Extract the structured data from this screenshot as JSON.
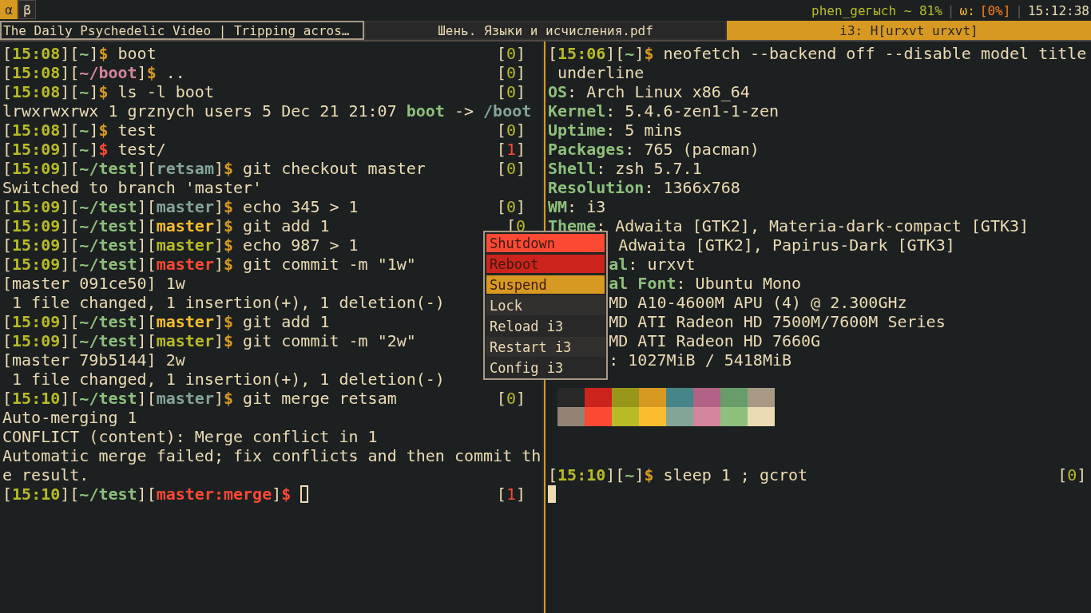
{
  "top_bar": {
    "workspaces": [
      {
        "label": "α",
        "selected": true
      },
      {
        "label": "β",
        "selected": false
      }
    ],
    "status": [
      {
        "text": "phen_geгысh ~ 81%",
        "kind": "net"
      },
      {
        "text": "|",
        "kind": "sep"
      },
      {
        "text": "ω:",
        "kind": "label"
      },
      {
        "text": "[0%]",
        "kind": "value"
      },
      {
        "text": "|",
        "kind": "sep"
      },
      {
        "text": "15:12:38",
        "kind": "clock"
      }
    ]
  },
  "tabs": [
    {
      "title": "The Daily Psychedelic Video | Tripping acros…",
      "kind": "focused-inactive",
      "selected": false
    },
    {
      "title": "Шень. Языки и исчисления.pdf",
      "kind": "unfocused",
      "selected": false
    },
    {
      "title": "i3: H[urxvt urxvt]",
      "kind": "unfocused",
      "selected": true
    }
  ],
  "left_terminal": {
    "lines": [
      {
        "segments": [
          {
            "text": "[",
            "kind": "text"
          },
          {
            "text": "15:08",
            "kind": "time"
          },
          {
            "text": "][",
            "kind": "text"
          },
          {
            "text": "~",
            "kind": "cwd"
          },
          {
            "text": "]",
            "kind": "text"
          },
          {
            "text": "$",
            "kind": "sign"
          },
          {
            "text": " boot",
            "kind": "text"
          }
        ],
        "status": [
          {
            "text": "[",
            "kind": "text"
          },
          {
            "text": "0",
            "kind": "ok"
          },
          {
            "text": "]",
            "kind": "text"
          }
        ]
      },
      {
        "segments": [
          {
            "text": "[",
            "kind": "text"
          },
          {
            "text": "15:08",
            "kind": "time"
          },
          {
            "text": "][",
            "kind": "text"
          },
          {
            "text": "~/boot",
            "kind": "cwd-link"
          },
          {
            "text": "]",
            "kind": "text"
          },
          {
            "text": "$",
            "kind": "sign"
          },
          {
            "text": " ..",
            "kind": "text"
          }
        ],
        "status": [
          {
            "text": "[",
            "kind": "text"
          },
          {
            "text": "0",
            "kind": "ok"
          },
          {
            "text": "]",
            "kind": "text"
          }
        ]
      },
      {
        "segments": [
          {
            "text": "[",
            "kind": "text"
          },
          {
            "text": "15:08",
            "kind": "time"
          },
          {
            "text": "][",
            "kind": "text"
          },
          {
            "text": "~",
            "kind": "cwd"
          },
          {
            "text": "]",
            "kind": "text"
          },
          {
            "text": "$",
            "kind": "sign"
          },
          {
            "text": " ls -l boot",
            "kind": "text"
          }
        ],
        "status": [
          {
            "text": "[",
            "kind": "text"
          },
          {
            "text": "0",
            "kind": "ok"
          },
          {
            "text": "]",
            "kind": "text"
          }
        ]
      },
      {
        "segments": [
          {
            "text": "lrwxrwxrwx 1 grznych users 5 Dec 21 21:07 ",
            "kind": "text"
          },
          {
            "text": "boot",
            "kind": "link-name"
          },
          {
            "text": " -> ",
            "kind": "text"
          },
          {
            "text": "/boot",
            "kind": "link-target"
          }
        ]
      },
      {
        "segments": [
          {
            "text": "[",
            "kind": "text"
          },
          {
            "text": "15:08",
            "kind": "time"
          },
          {
            "text": "][",
            "kind": "text"
          },
          {
            "text": "~",
            "kind": "cwd"
          },
          {
            "text": "]",
            "kind": "text"
          },
          {
            "text": "$",
            "kind": "sign"
          },
          {
            "text": " test",
            "kind": "text"
          }
        ],
        "status": [
          {
            "text": "[",
            "kind": "text"
          },
          {
            "text": "0",
            "kind": "ok"
          },
          {
            "text": "]",
            "kind": "text"
          }
        ]
      },
      {
        "segments": [
          {
            "text": "[",
            "kind": "text"
          },
          {
            "text": "15:09",
            "kind": "time"
          },
          {
            "text": "][",
            "kind": "text"
          },
          {
            "text": "~",
            "kind": "cwd"
          },
          {
            "text": "]",
            "kind": "text"
          },
          {
            "text": "$",
            "kind": "sign-error"
          },
          {
            "text": " test/",
            "kind": "text"
          }
        ],
        "status": [
          {
            "text": "[",
            "kind": "text"
          },
          {
            "text": "1",
            "kind": "error"
          },
          {
            "text": "]",
            "kind": "text"
          }
        ]
      },
      {
        "segments": [
          {
            "text": "[",
            "kind": "text"
          },
          {
            "text": "15:09",
            "kind": "time"
          },
          {
            "text": "][",
            "kind": "text"
          },
          {
            "text": "~/test",
            "kind": "cwd"
          },
          {
            "text": "][",
            "kind": "text"
          },
          {
            "text": "retsam",
            "kind": "branch-clean"
          },
          {
            "text": "]",
            "kind": "text"
          },
          {
            "text": "$",
            "kind": "sign"
          },
          {
            "text": " git checkout master",
            "kind": "text"
          }
        ],
        "status": [
          {
            "text": "[",
            "kind": "text"
          },
          {
            "text": "0",
            "kind": "ok"
          },
          {
            "text": "]",
            "kind": "text"
          }
        ]
      },
      {
        "segments": [
          {
            "text": "Switched to branch 'master'",
            "kind": "text"
          }
        ]
      },
      {
        "segments": [
          {
            "text": "[",
            "kind": "text"
          },
          {
            "text": "15:09",
            "kind": "time"
          },
          {
            "text": "][",
            "kind": "text"
          },
          {
            "text": "~/test",
            "kind": "cwd"
          },
          {
            "text": "][",
            "kind": "text"
          },
          {
            "text": "master",
            "kind": "branch-clean"
          },
          {
            "text": "]",
            "kind": "text"
          },
          {
            "text": "$",
            "kind": "sign"
          },
          {
            "text": " echo 345 > 1",
            "kind": "text"
          }
        ],
        "status": [
          {
            "text": "[",
            "kind": "text"
          },
          {
            "text": "0",
            "kind": "ok"
          },
          {
            "text": "]",
            "kind": "text"
          }
        ]
      },
      {
        "segments": [
          {
            "text": "[",
            "kind": "text"
          },
          {
            "text": "15:09",
            "kind": "time"
          },
          {
            "text": "][",
            "kind": "text"
          },
          {
            "text": "~/test",
            "kind": "cwd"
          },
          {
            "text": "][",
            "kind": "text"
          },
          {
            "text": "master",
            "kind": "branch-staged"
          },
          {
            "text": "]",
            "kind": "text"
          },
          {
            "text": "$",
            "kind": "sign"
          },
          {
            "text": " git add 1",
            "kind": "text"
          }
        ],
        "status": [
          {
            "text": "[",
            "kind": "text"
          },
          {
            "text": "0",
            "kind": "ok"
          }
        ]
      },
      {
        "segments": [
          {
            "text": "[",
            "kind": "text"
          },
          {
            "text": "15:09",
            "kind": "time"
          },
          {
            "text": "][",
            "kind": "text"
          },
          {
            "text": "~/test",
            "kind": "cwd"
          },
          {
            "text": "][",
            "kind": "text"
          },
          {
            "text": "master",
            "kind": "branch-modified"
          },
          {
            "text": "]",
            "kind": "text"
          },
          {
            "text": "$",
            "kind": "sign"
          },
          {
            "text": " echo 987 > 1",
            "kind": "text"
          }
        ]
      },
      {
        "segments": [
          {
            "text": "[",
            "kind": "text"
          },
          {
            "text": "15:09",
            "kind": "time"
          },
          {
            "text": "][",
            "kind": "text"
          },
          {
            "text": "~/test",
            "kind": "cwd"
          },
          {
            "text": "][",
            "kind": "text"
          },
          {
            "text": "master",
            "kind": "branch-conflict"
          },
          {
            "text": "]",
            "kind": "text"
          },
          {
            "text": "$",
            "kind": "sign"
          },
          {
            "text": " git commit -m \"1w\"",
            "kind": "text"
          }
        ]
      },
      {
        "segments": [
          {
            "text": "[master 091ce50] 1w",
            "kind": "text"
          }
        ]
      },
      {
        "segments": [
          {
            "text": " 1 file changed, 1 insertion(+), 1 deletion(-)",
            "kind": "text"
          }
        ]
      },
      {
        "segments": [
          {
            "text": "[",
            "kind": "text"
          },
          {
            "text": "15:09",
            "kind": "time"
          },
          {
            "text": "][",
            "kind": "text"
          },
          {
            "text": "~/test",
            "kind": "cwd"
          },
          {
            "text": "][",
            "kind": "text"
          },
          {
            "text": "master",
            "kind": "branch-staged"
          },
          {
            "text": "]",
            "kind": "text"
          },
          {
            "text": "$",
            "kind": "sign"
          },
          {
            "text": " git add 1",
            "kind": "text"
          }
        ]
      },
      {
        "segments": [
          {
            "text": "[",
            "kind": "text"
          },
          {
            "text": "15:09",
            "kind": "time"
          },
          {
            "text": "][",
            "kind": "text"
          },
          {
            "text": "~/test",
            "kind": "cwd"
          },
          {
            "text": "][",
            "kind": "text"
          },
          {
            "text": "master",
            "kind": "branch-modified"
          },
          {
            "text": "]",
            "kind": "text"
          },
          {
            "text": "$",
            "kind": "sign"
          },
          {
            "text": " git commit -m \"2w\"",
            "kind": "text"
          }
        ]
      },
      {
        "segments": [
          {
            "text": "[master 79b5144] 2w",
            "kind": "text"
          }
        ]
      },
      {
        "segments": [
          {
            "text": " 1 file changed, 1 insertion(+), 1 deletion(-)",
            "kind": "text"
          }
        ]
      },
      {
        "segments": [
          {
            "text": "[",
            "kind": "text"
          },
          {
            "text": "15:10",
            "kind": "time"
          },
          {
            "text": "][",
            "kind": "text"
          },
          {
            "text": "~/test",
            "kind": "cwd"
          },
          {
            "text": "][",
            "kind": "text"
          },
          {
            "text": "master",
            "kind": "branch-clean"
          },
          {
            "text": "]",
            "kind": "text"
          },
          {
            "text": "$",
            "kind": "sign"
          },
          {
            "text": " git merge retsam",
            "kind": "text"
          }
        ],
        "status": [
          {
            "text": "[",
            "kind": "text"
          },
          {
            "text": "0",
            "kind": "ok"
          },
          {
            "text": "]",
            "kind": "text"
          }
        ]
      },
      {
        "segments": [
          {
            "text": "Auto-merging 1",
            "kind": "text"
          }
        ]
      },
      {
        "segments": [
          {
            "text": "CONFLICT (content): Merge conflict in 1",
            "kind": "text"
          }
        ]
      },
      {
        "segments": [
          {
            "text": "Automatic merge failed; fix conflicts and then commit th",
            "kind": "text"
          }
        ]
      },
      {
        "segments": [
          {
            "text": "e result.",
            "kind": "text"
          }
        ]
      },
      {
        "segments": [
          {
            "text": "[",
            "kind": "text"
          },
          {
            "text": "15:10",
            "kind": "time"
          },
          {
            "text": "][",
            "kind": "text"
          },
          {
            "text": "~/test",
            "kind": "cwd"
          },
          {
            "text": "][",
            "kind": "text"
          },
          {
            "text": "master:merge",
            "kind": "branch-conflict"
          },
          {
            "text": "]",
            "kind": "text"
          },
          {
            "text": "$",
            "kind": "sign-error"
          }
        ],
        "cursor_filled": false,
        "status": [
          {
            "text": "[",
            "kind": "text"
          },
          {
            "text": "1",
            "kind": "error"
          },
          {
            "text": "]",
            "kind": "text"
          }
        ]
      }
    ]
  },
  "right_terminal": {
    "output": [
      {
        "segments": [
          {
            "text": "[",
            "kind": "text"
          },
          {
            "text": "15:06",
            "kind": "time"
          },
          {
            "text": "][",
            "kind": "text"
          },
          {
            "text": "~",
            "kind": "cwd"
          },
          {
            "text": "]",
            "kind": "text"
          },
          {
            "text": "$",
            "kind": "sign"
          },
          {
            "text": " neofetch --backend off --disable model title",
            "kind": "text"
          }
        ]
      },
      {
        "segments": [
          {
            "text": " underline",
            "kind": "text"
          }
        ]
      },
      {
        "segments": [
          {
            "text": "OS",
            "kind": "label"
          },
          {
            "text": ": Arch Linux x86_64",
            "kind": "text"
          }
        ]
      },
      {
        "segments": [
          {
            "text": "Kernel",
            "kind": "label"
          },
          {
            "text": ": 5.4.6-zen1-1-zen",
            "kind": "text"
          }
        ]
      },
      {
        "segments": [
          {
            "text": "Uptime",
            "kind": "label"
          },
          {
            "text": ": 5 mins",
            "kind": "text"
          }
        ]
      },
      {
        "segments": [
          {
            "text": "Packages",
            "kind": "label"
          },
          {
            "text": ": 765 (pacman)",
            "kind": "text"
          }
        ]
      },
      {
        "segments": [
          {
            "text": "Shell",
            "kind": "label"
          },
          {
            "text": ": zsh 5.7.1",
            "kind": "text"
          }
        ]
      },
      {
        "segments": [
          {
            "text": "Resolution",
            "kind": "label"
          },
          {
            "text": ": 1366x768",
            "kind": "text"
          }
        ]
      },
      {
        "segments": [
          {
            "text": "WM",
            "kind": "label"
          },
          {
            "text": ": i3",
            "kind": "text"
          }
        ]
      },
      {
        "segments": [
          {
            "text": "Theme",
            "kind": "label"
          },
          {
            "text": ": Adwaita [GTK2], Materia-dark-compact [GTK3]",
            "kind": "text"
          }
        ]
      },
      {
        "covered": true,
        "segments": [
          {
            "text": " Adwaita [GTK2], Papirus-Dark [GTK3]",
            "kind": "text"
          }
        ]
      },
      {
        "covered": true,
        "segments": [
          {
            "text": "al",
            "kind": "label"
          },
          {
            "text": ": urxvt",
            "kind": "text"
          }
        ]
      },
      {
        "covered": true,
        "segments": [
          {
            "text": "al Font",
            "kind": "label"
          },
          {
            "text": ": Ubuntu Mono",
            "kind": "text"
          }
        ]
      },
      {
        "covered": true,
        "segments": [
          {
            "text": "MD A10-4600M APU (4) @ 2.300GHz",
            "kind": "text"
          }
        ]
      },
      {
        "covered": true,
        "segments": [
          {
            "text": "MD ATI Radeon HD 7500M/7600M Series",
            "kind": "text"
          }
        ]
      },
      {
        "covered": true,
        "segments": [
          {
            "text": "MD ATI Radeon HD 7660G",
            "kind": "text"
          }
        ]
      },
      {
        "covered": true,
        "segments": [
          {
            "text": ": 1027MiB / 5418MiB",
            "kind": "text"
          }
        ]
      }
    ],
    "palette": [
      [
        {
          "color": "#282828"
        },
        {
          "color": "#cc241d"
        },
        {
          "color": "#98971a"
        },
        {
          "color": "#d79921"
        },
        {
          "color": "#458588"
        },
        {
          "color": "#b16286"
        },
        {
          "color": "#689d6a"
        },
        {
          "color": "#a89984"
        }
      ],
      [
        {
          "color": "#928374"
        },
        {
          "color": "#fb4934"
        },
        {
          "color": "#b8bb26"
        },
        {
          "color": "#fabd2f"
        },
        {
          "color": "#83a598"
        },
        {
          "color": "#d3869b"
        },
        {
          "color": "#8ec07c"
        },
        {
          "color": "#ebdbb2"
        }
      ]
    ],
    "prompt": [
      {
        "segments": [
          {
            "text": "[",
            "kind": "text"
          },
          {
            "text": "15:10",
            "kind": "time"
          },
          {
            "text": "][",
            "kind": "text"
          },
          {
            "text": "~",
            "kind": "cwd"
          },
          {
            "text": "]",
            "kind": "text"
          },
          {
            "text": "$",
            "kind": "sign"
          },
          {
            "text": " sleep 1 ; gcrot",
            "kind": "text"
          }
        ],
        "status": [
          {
            "text": "[",
            "kind": "text"
          },
          {
            "text": "0",
            "kind": "ok"
          },
          {
            "text": "]",
            "kind": "text"
          }
        ]
      },
      {
        "cursor_filled": true
      }
    ]
  },
  "power_menu": {
    "items": [
      {
        "label": "Shutdown",
        "color": "#fb4934"
      },
      {
        "label": "Reboot",
        "color": "#cc241d"
      },
      {
        "label": "Suspend",
        "color": "#d79921"
      },
      {
        "label": "Lock"
      },
      {
        "label": "Reload i3"
      },
      {
        "label": "Restart i3"
      },
      {
        "label": "Config i3"
      }
    ]
  }
}
